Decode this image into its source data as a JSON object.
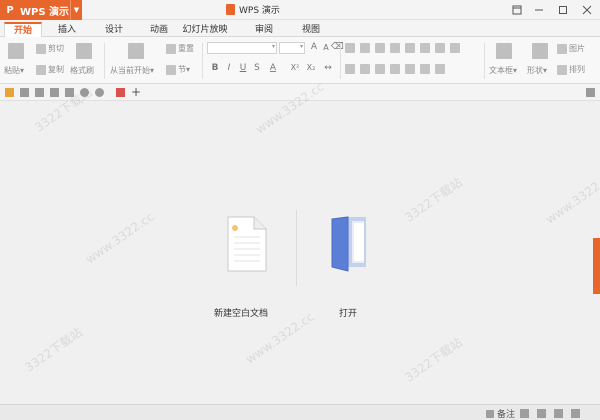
{
  "app": {
    "menu_title": "WPS 演示",
    "logo_letter": "P",
    "window_title": "WPS 演示"
  },
  "tabs": [
    {
      "label": "开始",
      "active": true
    },
    {
      "label": "插入",
      "active": false
    },
    {
      "label": "设计",
      "active": false
    },
    {
      "label": "动画",
      "active": false
    },
    {
      "label": "幻灯片放映",
      "active": false
    },
    {
      "label": "审阅",
      "active": false
    },
    {
      "label": "视图",
      "active": false
    }
  ],
  "ribbon": {
    "paste": "粘贴",
    "cut": "剪切",
    "copy": "复制",
    "format_painter": "格式刷",
    "from_current": "从当前开始",
    "reset": "重置",
    "section": "节",
    "bold": "B",
    "italic": "I",
    "underline": "U",
    "strike": "S",
    "font_color": "A",
    "superscript": "X²",
    "subscript": "X₂",
    "grow_font": "A",
    "shrink_font": "A",
    "textbox": "文本框",
    "shape": "形状",
    "picture": "图片",
    "arrange": "排列"
  },
  "start": {
    "new_blank": "新建空白文档",
    "open": "打开"
  },
  "status": {
    "note": "备注"
  },
  "watermarks": [
    "3322下载站",
    "www.3322.cc"
  ],
  "colors": {
    "accent": "#e8652b",
    "doc_blue": "#5b7fd6"
  }
}
